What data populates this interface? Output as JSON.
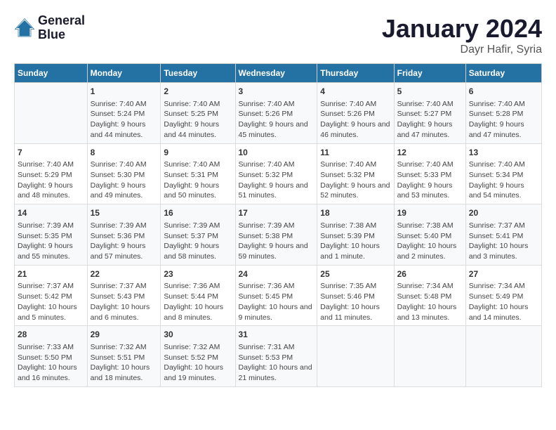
{
  "logo": {
    "line1": "General",
    "line2": "Blue"
  },
  "title": "January 2024",
  "subtitle": "Dayr Hafir, Syria",
  "weekdays": [
    "Sunday",
    "Monday",
    "Tuesday",
    "Wednesday",
    "Thursday",
    "Friday",
    "Saturday"
  ],
  "weeks": [
    [
      {
        "day": "",
        "sunrise": "",
        "sunset": "",
        "daylight": ""
      },
      {
        "day": "1",
        "sunrise": "Sunrise: 7:40 AM",
        "sunset": "Sunset: 5:24 PM",
        "daylight": "Daylight: 9 hours and 44 minutes."
      },
      {
        "day": "2",
        "sunrise": "Sunrise: 7:40 AM",
        "sunset": "Sunset: 5:25 PM",
        "daylight": "Daylight: 9 hours and 44 minutes."
      },
      {
        "day": "3",
        "sunrise": "Sunrise: 7:40 AM",
        "sunset": "Sunset: 5:26 PM",
        "daylight": "Daylight: 9 hours and 45 minutes."
      },
      {
        "day": "4",
        "sunrise": "Sunrise: 7:40 AM",
        "sunset": "Sunset: 5:26 PM",
        "daylight": "Daylight: 9 hours and 46 minutes."
      },
      {
        "day": "5",
        "sunrise": "Sunrise: 7:40 AM",
        "sunset": "Sunset: 5:27 PM",
        "daylight": "Daylight: 9 hours and 47 minutes."
      },
      {
        "day": "6",
        "sunrise": "Sunrise: 7:40 AM",
        "sunset": "Sunset: 5:28 PM",
        "daylight": "Daylight: 9 hours and 47 minutes."
      }
    ],
    [
      {
        "day": "7",
        "sunrise": "Sunrise: 7:40 AM",
        "sunset": "Sunset: 5:29 PM",
        "daylight": "Daylight: 9 hours and 48 minutes."
      },
      {
        "day": "8",
        "sunrise": "Sunrise: 7:40 AM",
        "sunset": "Sunset: 5:30 PM",
        "daylight": "Daylight: 9 hours and 49 minutes."
      },
      {
        "day": "9",
        "sunrise": "Sunrise: 7:40 AM",
        "sunset": "Sunset: 5:31 PM",
        "daylight": "Daylight: 9 hours and 50 minutes."
      },
      {
        "day": "10",
        "sunrise": "Sunrise: 7:40 AM",
        "sunset": "Sunset: 5:32 PM",
        "daylight": "Daylight: 9 hours and 51 minutes."
      },
      {
        "day": "11",
        "sunrise": "Sunrise: 7:40 AM",
        "sunset": "Sunset: 5:32 PM",
        "daylight": "Daylight: 9 hours and 52 minutes."
      },
      {
        "day": "12",
        "sunrise": "Sunrise: 7:40 AM",
        "sunset": "Sunset: 5:33 PM",
        "daylight": "Daylight: 9 hours and 53 minutes."
      },
      {
        "day": "13",
        "sunrise": "Sunrise: 7:40 AM",
        "sunset": "Sunset: 5:34 PM",
        "daylight": "Daylight: 9 hours and 54 minutes."
      }
    ],
    [
      {
        "day": "14",
        "sunrise": "Sunrise: 7:39 AM",
        "sunset": "Sunset: 5:35 PM",
        "daylight": "Daylight: 9 hours and 55 minutes."
      },
      {
        "day": "15",
        "sunrise": "Sunrise: 7:39 AM",
        "sunset": "Sunset: 5:36 PM",
        "daylight": "Daylight: 9 hours and 57 minutes."
      },
      {
        "day": "16",
        "sunrise": "Sunrise: 7:39 AM",
        "sunset": "Sunset: 5:37 PM",
        "daylight": "Daylight: 9 hours and 58 minutes."
      },
      {
        "day": "17",
        "sunrise": "Sunrise: 7:39 AM",
        "sunset": "Sunset: 5:38 PM",
        "daylight": "Daylight: 9 hours and 59 minutes."
      },
      {
        "day": "18",
        "sunrise": "Sunrise: 7:38 AM",
        "sunset": "Sunset: 5:39 PM",
        "daylight": "Daylight: 10 hours and 1 minute."
      },
      {
        "day": "19",
        "sunrise": "Sunrise: 7:38 AM",
        "sunset": "Sunset: 5:40 PM",
        "daylight": "Daylight: 10 hours and 2 minutes."
      },
      {
        "day": "20",
        "sunrise": "Sunrise: 7:37 AM",
        "sunset": "Sunset: 5:41 PM",
        "daylight": "Daylight: 10 hours and 3 minutes."
      }
    ],
    [
      {
        "day": "21",
        "sunrise": "Sunrise: 7:37 AM",
        "sunset": "Sunset: 5:42 PM",
        "daylight": "Daylight: 10 hours and 5 minutes."
      },
      {
        "day": "22",
        "sunrise": "Sunrise: 7:37 AM",
        "sunset": "Sunset: 5:43 PM",
        "daylight": "Daylight: 10 hours and 6 minutes."
      },
      {
        "day": "23",
        "sunrise": "Sunrise: 7:36 AM",
        "sunset": "Sunset: 5:44 PM",
        "daylight": "Daylight: 10 hours and 8 minutes."
      },
      {
        "day": "24",
        "sunrise": "Sunrise: 7:36 AM",
        "sunset": "Sunset: 5:45 PM",
        "daylight": "Daylight: 10 hours and 9 minutes."
      },
      {
        "day": "25",
        "sunrise": "Sunrise: 7:35 AM",
        "sunset": "Sunset: 5:46 PM",
        "daylight": "Daylight: 10 hours and 11 minutes."
      },
      {
        "day": "26",
        "sunrise": "Sunrise: 7:34 AM",
        "sunset": "Sunset: 5:48 PM",
        "daylight": "Daylight: 10 hours and 13 minutes."
      },
      {
        "day": "27",
        "sunrise": "Sunrise: 7:34 AM",
        "sunset": "Sunset: 5:49 PM",
        "daylight": "Daylight: 10 hours and 14 minutes."
      }
    ],
    [
      {
        "day": "28",
        "sunrise": "Sunrise: 7:33 AM",
        "sunset": "Sunset: 5:50 PM",
        "daylight": "Daylight: 10 hours and 16 minutes."
      },
      {
        "day": "29",
        "sunrise": "Sunrise: 7:32 AM",
        "sunset": "Sunset: 5:51 PM",
        "daylight": "Daylight: 10 hours and 18 minutes."
      },
      {
        "day": "30",
        "sunrise": "Sunrise: 7:32 AM",
        "sunset": "Sunset: 5:52 PM",
        "daylight": "Daylight: 10 hours and 19 minutes."
      },
      {
        "day": "31",
        "sunrise": "Sunrise: 7:31 AM",
        "sunset": "Sunset: 5:53 PM",
        "daylight": "Daylight: 10 hours and 21 minutes."
      },
      {
        "day": "",
        "sunrise": "",
        "sunset": "",
        "daylight": ""
      },
      {
        "day": "",
        "sunrise": "",
        "sunset": "",
        "daylight": ""
      },
      {
        "day": "",
        "sunrise": "",
        "sunset": "",
        "daylight": ""
      }
    ]
  ]
}
